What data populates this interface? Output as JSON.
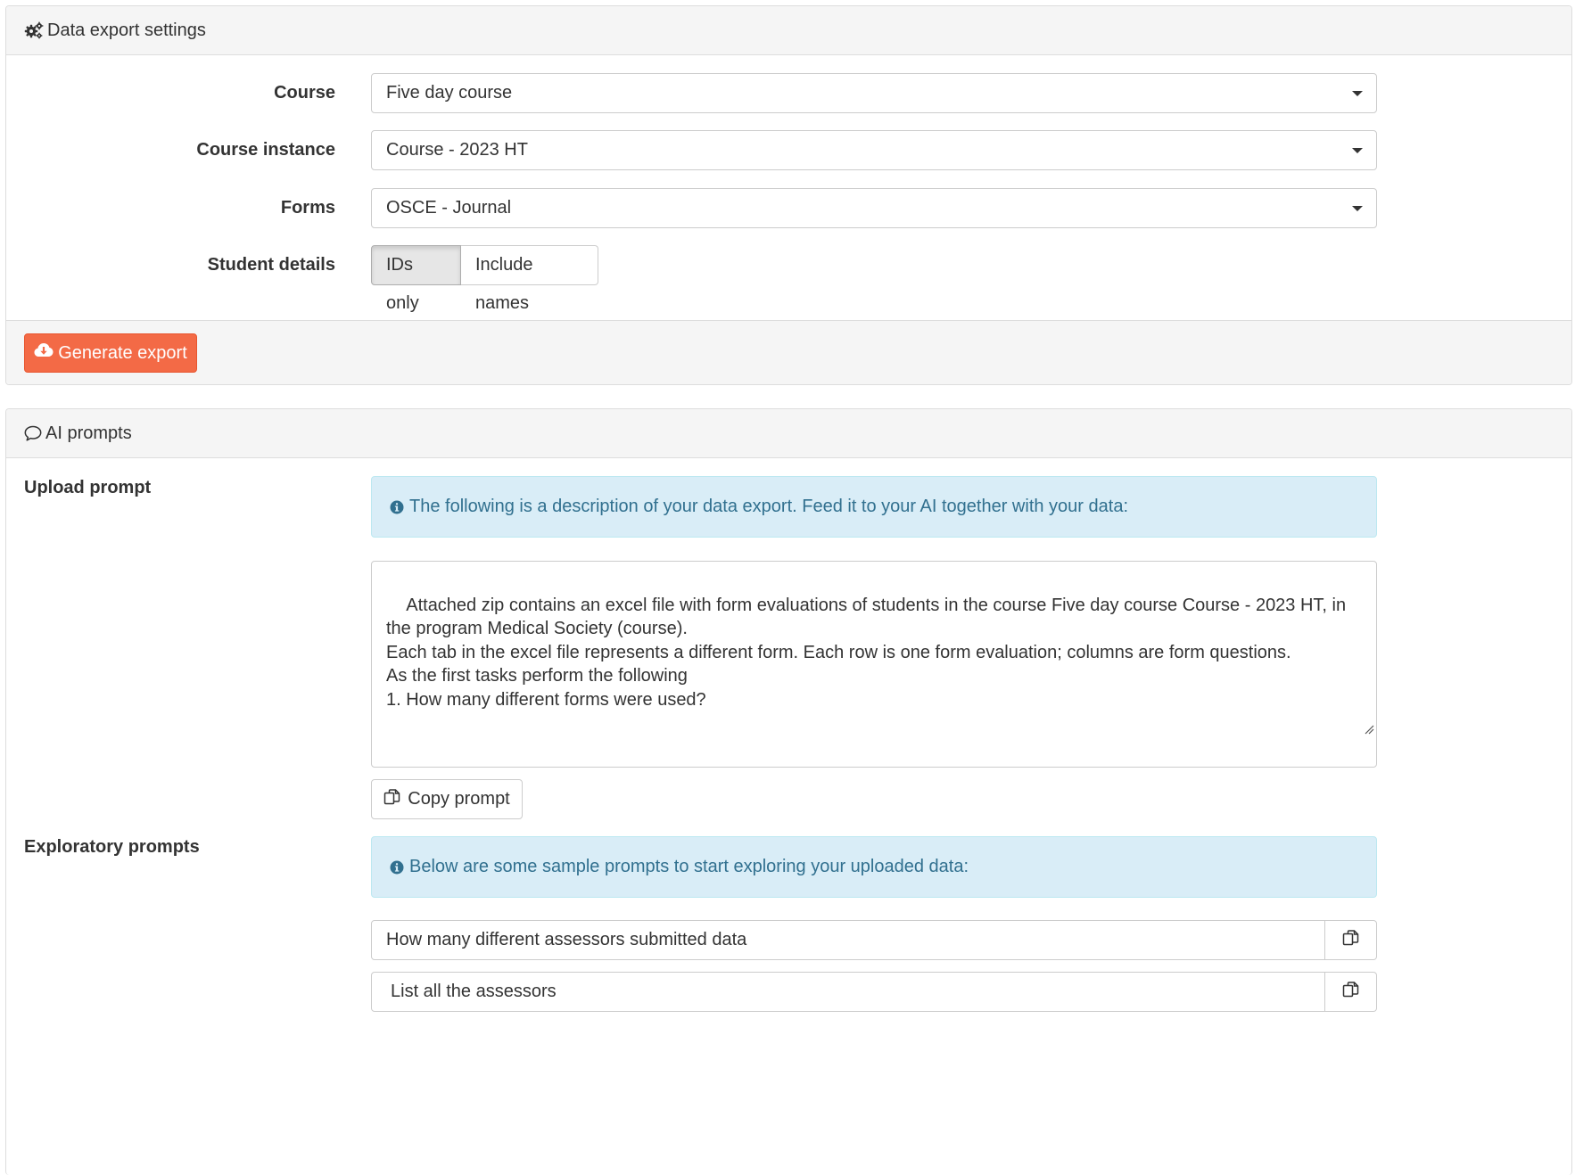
{
  "export_panel": {
    "title": "Data export settings",
    "course_label": "Course",
    "course_value": "Five day course",
    "instance_label": "Course instance",
    "instance_value": "Course - 2023 HT",
    "forms_label": "Forms",
    "forms_value": "OSCE - Journal",
    "student_details_label": "Student details",
    "student_details_options": [
      "IDs only",
      "Include names"
    ],
    "student_details_selected": "IDs only",
    "generate_button": "Generate export"
  },
  "ai_panel": {
    "title": "AI prompts",
    "upload_label": "Upload prompt",
    "upload_info": "The following is a description of your data export. Feed it to your AI together with your data:",
    "upload_prompt_text": "Attached zip contains an excel file with form evaluations of students in the course Five day course Course - 2023 HT, in the program Medical Society (course).\nEach tab in the excel file represents a different form. Each row is one form evaluation; columns are form questions.\nAs the first tasks perform the following\n1. How many different forms were used?",
    "copy_button": "Copy prompt",
    "exploratory_label": "Exploratory prompts",
    "exploratory_info": "Below are some sample prompts to start exploring your uploaded data:",
    "exploratory_prompts": [
      "How many different assessors submitted data",
      "List all the assessors"
    ]
  },
  "colors": {
    "accent_button": "#f36a46",
    "info_background": "#d9edf7",
    "info_text": "#31708f"
  },
  "icons": {
    "export_heading": "gears-icon",
    "ai_heading": "comment-icon",
    "generate": "cloud-download-icon",
    "info": "info-circle-icon",
    "copy": "copy-icon"
  }
}
